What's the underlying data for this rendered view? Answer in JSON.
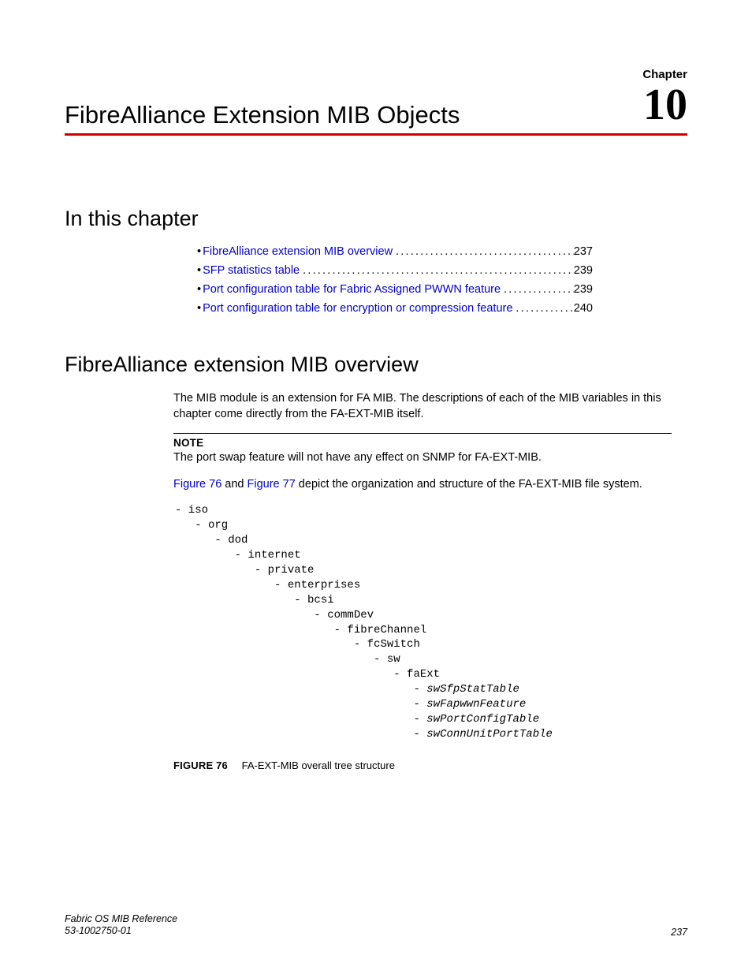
{
  "header": {
    "chapter_label": "Chapter",
    "chapter_number": "10",
    "title": "FibreAlliance Extension MIB Objects"
  },
  "sections": {
    "in_this_chapter": "In this chapter",
    "overview_heading": "FibreAlliance extension MIB overview"
  },
  "toc": [
    {
      "label": "FibreAlliance extension MIB overview",
      "page": "237"
    },
    {
      "label": "SFP statistics table",
      "page": "239"
    },
    {
      "label": "Port configuration table for Fabric Assigned PWWN feature",
      "page": "239"
    },
    {
      "label": "Port configuration table for encryption or compression feature",
      "page": "240"
    }
  ],
  "overview": {
    "para1": "The MIB module is an extension for FA MIB. The descriptions of each of the MIB variables in this chapter come directly from the FA-EXT-MIB itself.",
    "note_label": "NOTE",
    "note_text": "The port swap feature will not have any effect on SNMP for FA-EXT-MIB.",
    "fig_sentence_pre": "",
    "fig76": "Figure 76",
    "fig_and": " and ",
    "fig77": "Figure 77",
    "fig_sentence_post": " depict the organization and structure of the FA-EXT-MIB file system."
  },
  "tree": {
    "l0": "- iso",
    "l1": "   - org",
    "l2": "      - dod",
    "l3": "         - internet",
    "l4": "            - private",
    "l5": "               - enterprises",
    "l6": "                  - bcsi",
    "l7": "                     - commDev",
    "l8": "                        - fibreChannel",
    "l9": "                           - fcSwitch",
    "l10": "                              - sw",
    "l11": "                                 - faExt",
    "l12p": "                                    - ",
    "l12i": "swSfpStatTable",
    "l13p": "                                    - ",
    "l13i": "swFapwwnFeature",
    "l14p": "                                    - ",
    "l14i": "swPortConfigTable",
    "l15p": "                                    - ",
    "l15i": "swConnUnitPortTable"
  },
  "figure": {
    "label": "FIGURE 76",
    "caption": "FA-EXT-MIB overall tree structure"
  },
  "footer": {
    "doc_title": "Fabric OS MIB Reference",
    "doc_number": "53-1002750-01",
    "page": "237"
  }
}
